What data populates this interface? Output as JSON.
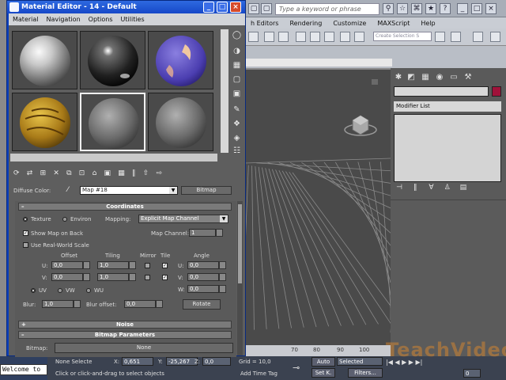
{
  "max": {
    "search_placeholder": "Type a keyword or phrase",
    "menu": [
      "h Editors",
      "Rendering",
      "Customize",
      "MAXScript",
      "Help"
    ],
    "selection_set": "Create Selection S",
    "modifier_list": "Modifier List",
    "ruler_ticks": [
      "70",
      "80",
      "90",
      "100"
    ],
    "colors": {
      "object_color": "#a0123a",
      "viewport_bg": "#4a4a4a"
    }
  },
  "material_editor": {
    "title": "Material Editor - 14 - Default",
    "menu": [
      "Material",
      "Navigation",
      "Options",
      "Utilities"
    ],
    "diffuse_label": "Diffuse Color:",
    "map_name": "Map #18",
    "map_type": "Bitmap",
    "coordinates": {
      "header": "Coordinates",
      "texture_label": "Texture",
      "environ_label": "Environ",
      "mapping_label": "Mapping:",
      "mapping_value": "Explicit Map Channel",
      "show_map_on_back": "Show Map on Back",
      "map_channel_label": "Map Channel:",
      "map_channel_value": "1",
      "real_world_scale": "Use Real-World Scale",
      "col_offset": "Offset",
      "col_tiling": "Tiling",
      "col_mirror": "Mirror",
      "col_tile": "Tile",
      "col_angle": "Angle",
      "u_label": "U:",
      "v_label": "V:",
      "w_label": "W:",
      "offset_u": "0,0",
      "offset_v": "0,0",
      "tiling_u": "1,0",
      "tiling_v": "1,0",
      "angle_u": "0,0",
      "angle_v": "0,0",
      "angle_w": "0,0",
      "uv_label": "UV",
      "vw_label": "VW",
      "wu_label": "WU",
      "blur_label": "Blur:",
      "blur_value": "1,0",
      "blur_offset_label": "Blur offset:",
      "blur_offset_value": "0,0",
      "rotate_label": "Rotate"
    },
    "noise_header": "Noise",
    "bitmap_header": "Bitmap Parameters",
    "bitmap_label": "Bitmap:",
    "bitmap_value": "None"
  },
  "status": {
    "welcome": "Welcome to",
    "none_selected": "None Selecte",
    "x_label": "X:",
    "x_value": "0,651",
    "y_label": "Y:",
    "y_value": "-25,267",
    "z_label": "Z:",
    "z_value": "0,0",
    "grid": "Grid = 10,0",
    "auto": "Auto",
    "selected": "Selected",
    "set_k": "Set K.",
    "filters": "Filters...",
    "prompt": "Click or click-and-drag to select objects",
    "add_time_tag": "Add Time Tag",
    "frame": "0",
    "watermark": "TeachVideo"
  }
}
